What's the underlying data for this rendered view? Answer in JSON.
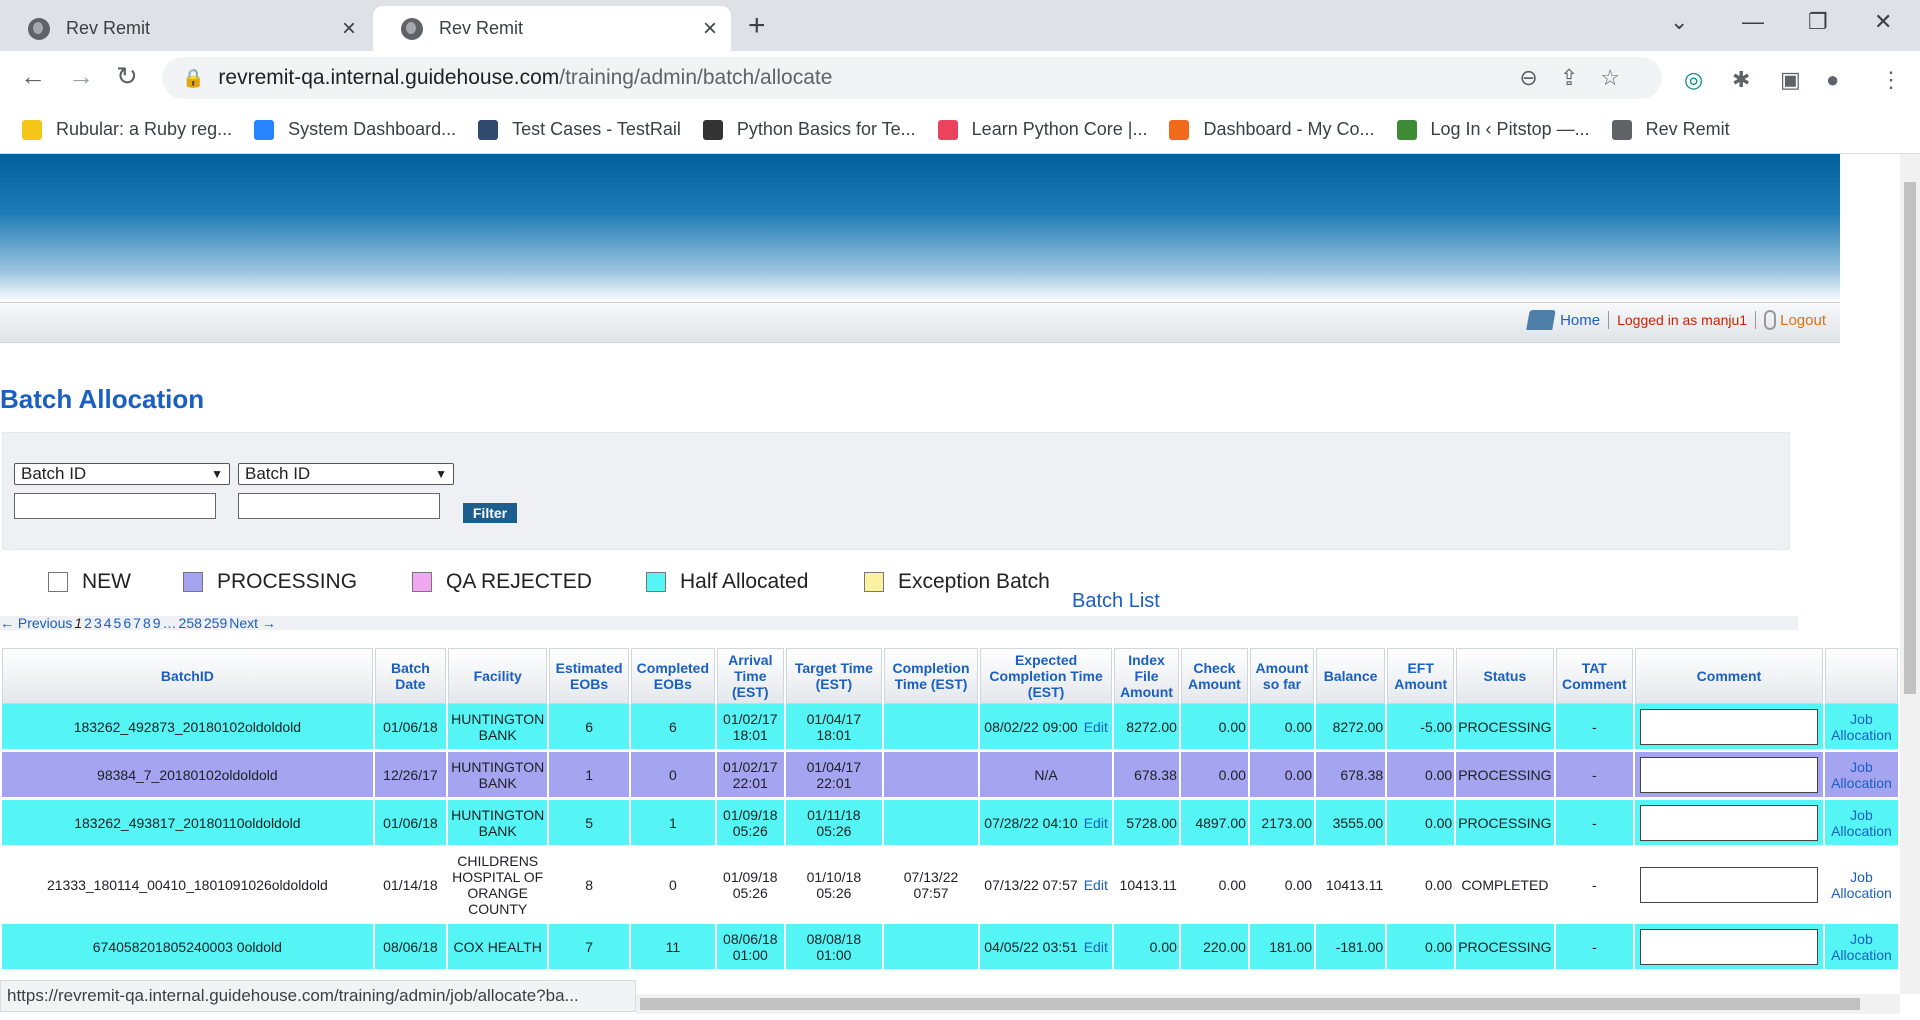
{
  "browser": {
    "tabs": [
      {
        "label": "Rev Remit"
      },
      {
        "label": "Rev Remit"
      }
    ],
    "url_host": "revremit-qa.internal.guidehouse.com",
    "url_path": "/training/admin/batch/allocate",
    "bookmarks": [
      {
        "label": "Rubular: a Ruby reg...",
        "color": "#f5c518"
      },
      {
        "label": "System Dashboard...",
        "color": "#2684ff"
      },
      {
        "label": "Test Cases - TestRail",
        "color": "#2f4a6d"
      },
      {
        "label": "Python Basics for Te...",
        "color": "#333333"
      },
      {
        "label": "Learn Python Core |...",
        "color": "#e9435e"
      },
      {
        "label": "Dashboard - My Co...",
        "color": "#f26b1d"
      },
      {
        "label": "Log In ‹ Pitstop —...",
        "color": "#3d8b37"
      },
      {
        "label": "Rev Remit",
        "color": "#5f6368"
      }
    ],
    "status_url": "https://revremit-qa.internal.guidehouse.com/training/admin/job/allocate?ba..."
  },
  "header": {
    "home": "Home",
    "logged_in": "Logged in as manju1",
    "logout": "Logout"
  },
  "page": {
    "title": "Batch Allocation",
    "filter": {
      "select1": "Batch ID",
      "select2": "Batch ID",
      "button": "Filter"
    },
    "legend": [
      {
        "label": "NEW",
        "color": "#ffffff"
      },
      {
        "label": "PROCESSING",
        "color": "#a4a4f0"
      },
      {
        "label": "QA REJECTED",
        "color": "#f0a8f0"
      },
      {
        "label": "Half Allocated",
        "color": "#55f5f5"
      },
      {
        "label": "Exception Batch",
        "color": "#fbf2a0"
      }
    ],
    "batch_list": "Batch List",
    "pager": {
      "prev": "← Previous",
      "current": "1",
      "pages": [
        "2",
        "3",
        "4",
        "5",
        "6",
        "7",
        "8",
        "9"
      ],
      "ellipsis": "…",
      "last": [
        "258",
        "259"
      ],
      "next": "Next →"
    }
  },
  "table": {
    "headers": [
      "BatchID",
      "Batch Date",
      "Facility",
      "Estimated EOBs",
      "Completed EOBs",
      "Arrival Time (EST)",
      "Target Time (EST)",
      "Completion Time (EST)",
      "Expected Completion Time (EST)",
      "Index File Amount",
      "Check Amount",
      "Amount so far",
      "Balance",
      "EFT Amount",
      "Status",
      "TAT Comment",
      "Comment",
      ""
    ],
    "edit_label": "Edit",
    "job_label": "Job Allocation",
    "rows": [
      {
        "color": "#55f5f5",
        "batch_id": "183262_492873_20180102oldoldold",
        "batch_date": "01/06/18",
        "facility": "HUNTINGTON BANK",
        "est": "6",
        "comp": "6",
        "arrival": "01/02/17 18:01",
        "target": "01/04/17 18:01",
        "completion": "",
        "expected": "08/02/22 09:00",
        "edit": true,
        "index": "8272.00",
        "check": "0.00",
        "sofar": "0.00",
        "balance": "8272.00",
        "eft": "-5.00",
        "status": "PROCESSING",
        "tat": "-"
      },
      {
        "color": "#a4a4f0",
        "batch_id": "98384_7_20180102oldoldold",
        "batch_date": "12/26/17",
        "facility": "HUNTINGTON BANK",
        "est": "1",
        "comp": "0",
        "arrival": "01/02/17 22:01",
        "target": "01/04/17 22:01",
        "completion": "",
        "expected": "N/A",
        "edit": false,
        "index": "678.38",
        "check": "0.00",
        "sofar": "0.00",
        "balance": "678.38",
        "eft": "0.00",
        "status": "PROCESSING",
        "tat": "-"
      },
      {
        "color": "#55f5f5",
        "batch_id": "183262_493817_20180110oldoldold",
        "batch_date": "01/06/18",
        "facility": "HUNTINGTON BANK",
        "est": "5",
        "comp": "1",
        "arrival": "01/09/18 05:26",
        "target": "01/11/18 05:26",
        "completion": "",
        "expected": "07/28/22 04:10",
        "edit": true,
        "index": "5728.00",
        "check": "4897.00",
        "sofar": "2173.00",
        "balance": "3555.00",
        "eft": "0.00",
        "status": "PROCESSING",
        "tat": "-"
      },
      {
        "color": "#ffffff",
        "batch_id": "21333_180114_00410_1801091026oldoldold",
        "batch_date": "01/14/18",
        "facility": "CHILDRENS HOSPITAL OF ORANGE COUNTY",
        "est": "8",
        "comp": "0",
        "arrival": "01/09/18 05:26",
        "target": "01/10/18 05:26",
        "completion": "07/13/22 07:57",
        "expected": "07/13/22 07:57",
        "edit": true,
        "index": "10413.11",
        "check": "0.00",
        "sofar": "0.00",
        "balance": "10413.11",
        "eft": "0.00",
        "status": "COMPLETED",
        "tat": "-"
      },
      {
        "color": "#55f5f5",
        "batch_id": "674058201805240003 0oldold",
        "batch_date": "08/06/18",
        "facility": "COX HEALTH",
        "est": "7",
        "comp": "11",
        "arrival": "08/06/18 01:00",
        "target": "08/08/18 01:00",
        "completion": "",
        "expected": "04/05/22 03:51",
        "edit": true,
        "index": "0.00",
        "check": "220.00",
        "sofar": "181.00",
        "balance": "-181.00",
        "eft": "0.00",
        "status": "PROCESSING",
        "tat": "-"
      }
    ]
  }
}
